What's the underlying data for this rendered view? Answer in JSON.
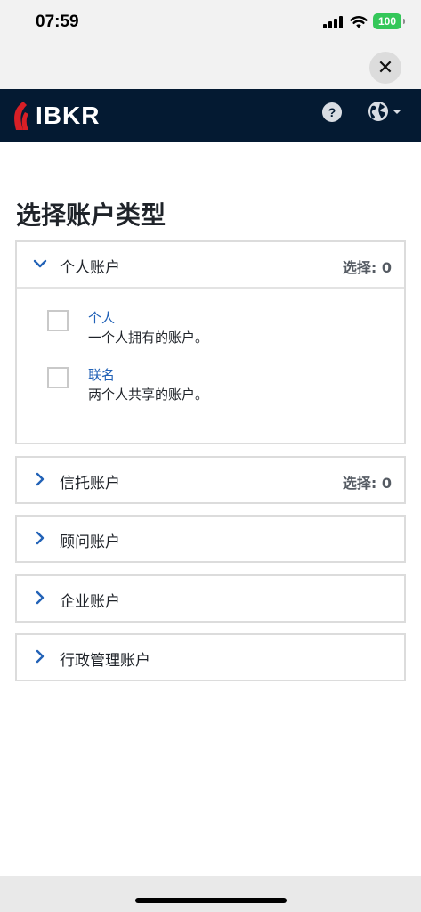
{
  "status_bar": {
    "time": "07:59",
    "battery": "100"
  },
  "navbar": {
    "brand": "IBKR",
    "help_symbol": "?"
  },
  "close_symbol": "✕",
  "page": {
    "title": "选择账户类型"
  },
  "sections": [
    {
      "label": "个人账户",
      "count": "选择: 0",
      "expanded": true,
      "options": [
        {
          "title": "个人",
          "description": "一个人拥有的账户。"
        },
        {
          "title": "联名",
          "description": "两个人共享的账户。"
        }
      ]
    },
    {
      "label": "信托账户",
      "count": "选择: 0",
      "expanded": false
    },
    {
      "label": "顾问账户",
      "count": "",
      "expanded": false
    },
    {
      "label": "企业账户",
      "count": "",
      "expanded": false
    },
    {
      "label": "行政管理账户",
      "count": "",
      "expanded": false
    }
  ],
  "colors": {
    "navbar_bg": "#041a32",
    "accent_blue": "#2262b7",
    "logo_red": "#d81f26",
    "battery_green": "#34c759"
  }
}
